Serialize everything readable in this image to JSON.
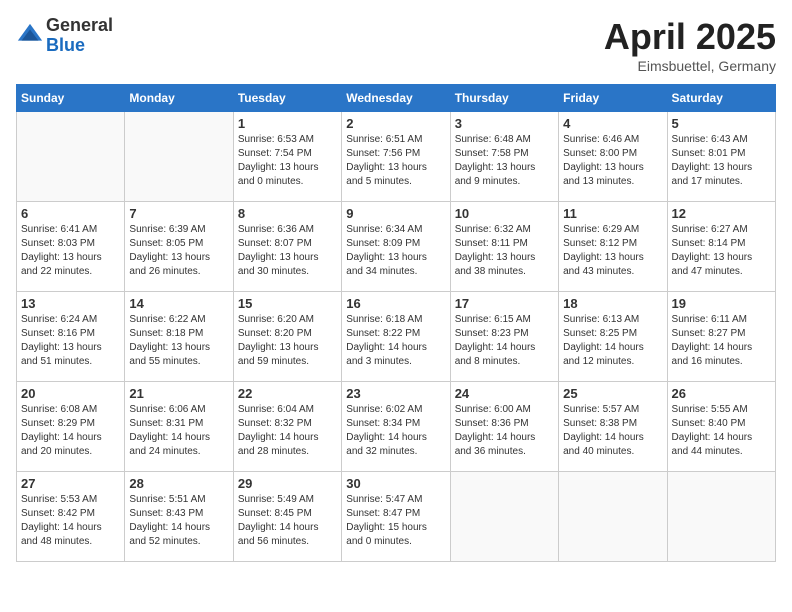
{
  "header": {
    "logo_general": "General",
    "logo_blue": "Blue",
    "month_title": "April 2025",
    "location": "Eimsbuettel, Germany"
  },
  "days_of_week": [
    "Sunday",
    "Monday",
    "Tuesday",
    "Wednesday",
    "Thursday",
    "Friday",
    "Saturday"
  ],
  "weeks": [
    [
      {
        "day": "",
        "info": ""
      },
      {
        "day": "",
        "info": ""
      },
      {
        "day": "1",
        "info": "Sunrise: 6:53 AM\nSunset: 7:54 PM\nDaylight: 13 hours and 0 minutes."
      },
      {
        "day": "2",
        "info": "Sunrise: 6:51 AM\nSunset: 7:56 PM\nDaylight: 13 hours and 5 minutes."
      },
      {
        "day": "3",
        "info": "Sunrise: 6:48 AM\nSunset: 7:58 PM\nDaylight: 13 hours and 9 minutes."
      },
      {
        "day": "4",
        "info": "Sunrise: 6:46 AM\nSunset: 8:00 PM\nDaylight: 13 hours and 13 minutes."
      },
      {
        "day": "5",
        "info": "Sunrise: 6:43 AM\nSunset: 8:01 PM\nDaylight: 13 hours and 17 minutes."
      }
    ],
    [
      {
        "day": "6",
        "info": "Sunrise: 6:41 AM\nSunset: 8:03 PM\nDaylight: 13 hours and 22 minutes."
      },
      {
        "day": "7",
        "info": "Sunrise: 6:39 AM\nSunset: 8:05 PM\nDaylight: 13 hours and 26 minutes."
      },
      {
        "day": "8",
        "info": "Sunrise: 6:36 AM\nSunset: 8:07 PM\nDaylight: 13 hours and 30 minutes."
      },
      {
        "day": "9",
        "info": "Sunrise: 6:34 AM\nSunset: 8:09 PM\nDaylight: 13 hours and 34 minutes."
      },
      {
        "day": "10",
        "info": "Sunrise: 6:32 AM\nSunset: 8:11 PM\nDaylight: 13 hours and 38 minutes."
      },
      {
        "day": "11",
        "info": "Sunrise: 6:29 AM\nSunset: 8:12 PM\nDaylight: 13 hours and 43 minutes."
      },
      {
        "day": "12",
        "info": "Sunrise: 6:27 AM\nSunset: 8:14 PM\nDaylight: 13 hours and 47 minutes."
      }
    ],
    [
      {
        "day": "13",
        "info": "Sunrise: 6:24 AM\nSunset: 8:16 PM\nDaylight: 13 hours and 51 minutes."
      },
      {
        "day": "14",
        "info": "Sunrise: 6:22 AM\nSunset: 8:18 PM\nDaylight: 13 hours and 55 minutes."
      },
      {
        "day": "15",
        "info": "Sunrise: 6:20 AM\nSunset: 8:20 PM\nDaylight: 13 hours and 59 minutes."
      },
      {
        "day": "16",
        "info": "Sunrise: 6:18 AM\nSunset: 8:22 PM\nDaylight: 14 hours and 3 minutes."
      },
      {
        "day": "17",
        "info": "Sunrise: 6:15 AM\nSunset: 8:23 PM\nDaylight: 14 hours and 8 minutes."
      },
      {
        "day": "18",
        "info": "Sunrise: 6:13 AM\nSunset: 8:25 PM\nDaylight: 14 hours and 12 minutes."
      },
      {
        "day": "19",
        "info": "Sunrise: 6:11 AM\nSunset: 8:27 PM\nDaylight: 14 hours and 16 minutes."
      }
    ],
    [
      {
        "day": "20",
        "info": "Sunrise: 6:08 AM\nSunset: 8:29 PM\nDaylight: 14 hours and 20 minutes."
      },
      {
        "day": "21",
        "info": "Sunrise: 6:06 AM\nSunset: 8:31 PM\nDaylight: 14 hours and 24 minutes."
      },
      {
        "day": "22",
        "info": "Sunrise: 6:04 AM\nSunset: 8:32 PM\nDaylight: 14 hours and 28 minutes."
      },
      {
        "day": "23",
        "info": "Sunrise: 6:02 AM\nSunset: 8:34 PM\nDaylight: 14 hours and 32 minutes."
      },
      {
        "day": "24",
        "info": "Sunrise: 6:00 AM\nSunset: 8:36 PM\nDaylight: 14 hours and 36 minutes."
      },
      {
        "day": "25",
        "info": "Sunrise: 5:57 AM\nSunset: 8:38 PM\nDaylight: 14 hours and 40 minutes."
      },
      {
        "day": "26",
        "info": "Sunrise: 5:55 AM\nSunset: 8:40 PM\nDaylight: 14 hours and 44 minutes."
      }
    ],
    [
      {
        "day": "27",
        "info": "Sunrise: 5:53 AM\nSunset: 8:42 PM\nDaylight: 14 hours and 48 minutes."
      },
      {
        "day": "28",
        "info": "Sunrise: 5:51 AM\nSunset: 8:43 PM\nDaylight: 14 hours and 52 minutes."
      },
      {
        "day": "29",
        "info": "Sunrise: 5:49 AM\nSunset: 8:45 PM\nDaylight: 14 hours and 56 minutes."
      },
      {
        "day": "30",
        "info": "Sunrise: 5:47 AM\nSunset: 8:47 PM\nDaylight: 15 hours and 0 minutes."
      },
      {
        "day": "",
        "info": ""
      },
      {
        "day": "",
        "info": ""
      },
      {
        "day": "",
        "info": ""
      }
    ]
  ]
}
